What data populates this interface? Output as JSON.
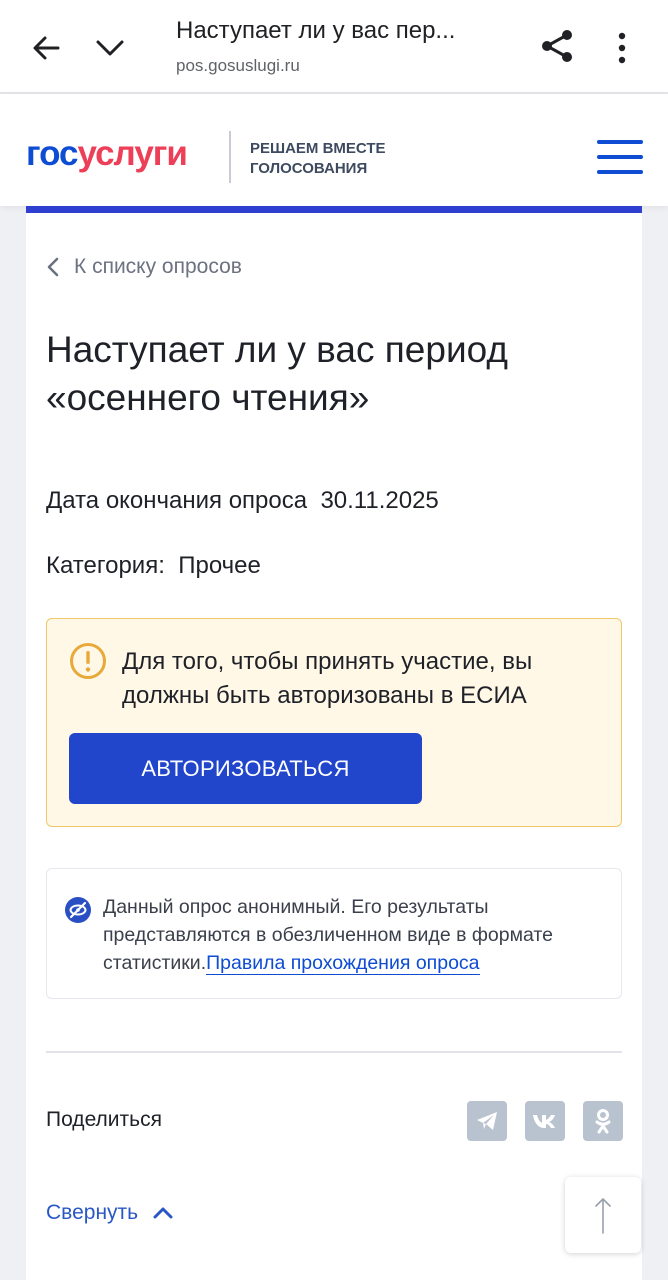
{
  "browser": {
    "page_title": "Наступает ли у вас пер...",
    "url": "pos.gosuslugi.ru"
  },
  "header": {
    "logo_part1": "гос",
    "logo_part2": "услуги",
    "tagline_line1": "РЕШАЕМ ВМЕСТЕ",
    "tagline_line2": "ГОЛОСОВАНИЯ"
  },
  "poll": {
    "back_link": "К списку опросов",
    "title": "Наступает ли у вас период «осеннего чтения»",
    "end_date_label": "Дата окончания опроса",
    "end_date_value": "30.11.2025",
    "category_label": "Категория:",
    "category_value": "Прочее"
  },
  "auth_notice": {
    "text": "Для того, чтобы принять участие, вы должны быть авторизованы в ЕСИА",
    "button_label": "АВТОРИЗОВАТЬСЯ"
  },
  "anon_notice": {
    "text": "Данный опрос анонимный. Его результаты представляются в обезличенном виде в формате статистики.",
    "link": "Правила прохождения опроса"
  },
  "share": {
    "label": "Поделиться",
    "networks": [
      "telegram-icon",
      "vk-icon",
      "odnoklassniki-icon"
    ]
  },
  "collapse_label": "Свернуть",
  "colors": {
    "brand_blue": "#0d4cd3",
    "brand_red": "#ee3f58",
    "button_blue": "#2146cc",
    "warning_bg": "#fff8e7",
    "warning_border": "#f0c76b"
  }
}
